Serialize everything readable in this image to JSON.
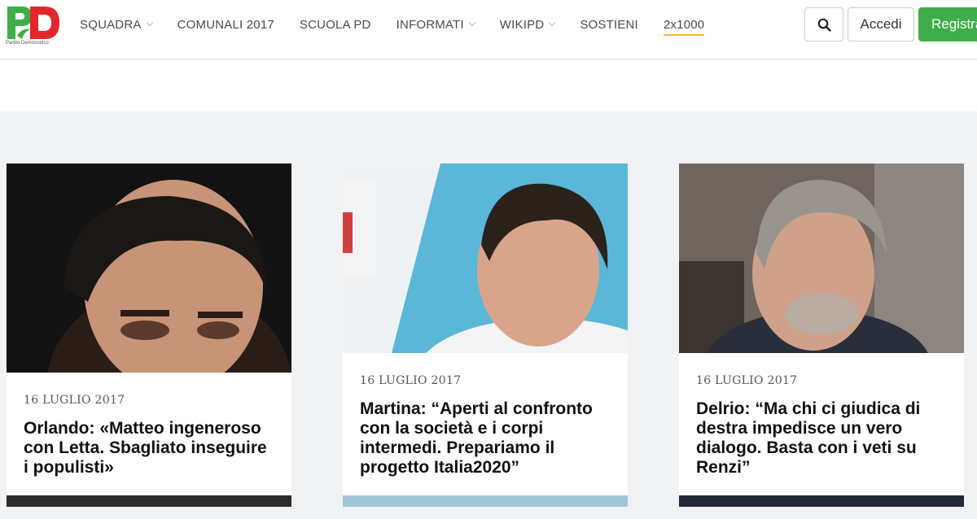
{
  "header": {
    "logo_alt": "PD",
    "logo_tagline": "Partito Democratico",
    "nav": [
      {
        "label": "SQUADRA",
        "dropdown": true
      },
      {
        "label": "COMUNALI 2017",
        "dropdown": false
      },
      {
        "label": "SCUOLA PD",
        "dropdown": false
      },
      {
        "label": "INFORMATI",
        "dropdown": true
      },
      {
        "label": "WIKIPD",
        "dropdown": true
      },
      {
        "label": "SOSTIENI",
        "dropdown": false
      },
      {
        "label": "2x1000",
        "dropdown": false,
        "highlight": true
      }
    ],
    "search_icon": "search-icon",
    "login_label": "Accedi",
    "register_label": "Registrati"
  },
  "colors": {
    "brand_green": "#3fae49",
    "brand_red": "#e3262b",
    "highlight_underline": "#f2b632",
    "page_bg": "#f1f2f4"
  },
  "articles": [
    {
      "date": "16 LUGLIO 2017",
      "title_lines": [
        "Orlando: «Matteo ingeneroso",
        "con Letta. Sbagliato inseguire",
        "i populisti»"
      ]
    },
    {
      "date": "16 LUGLIO 2017",
      "title_lines": [
        "Martina: “Aperti al confronto",
        "con la società e i corpi",
        "intermedi. Prepariamo il",
        "progetto Italia2020”"
      ]
    },
    {
      "date": "16 LUGLIO 2017",
      "title_lines": [
        "Delrio: “Ma chi ci giudica di",
        "destra impedisce un vero",
        "dialogo. Basta con i veti su",
        "Renzi”"
      ]
    }
  ]
}
